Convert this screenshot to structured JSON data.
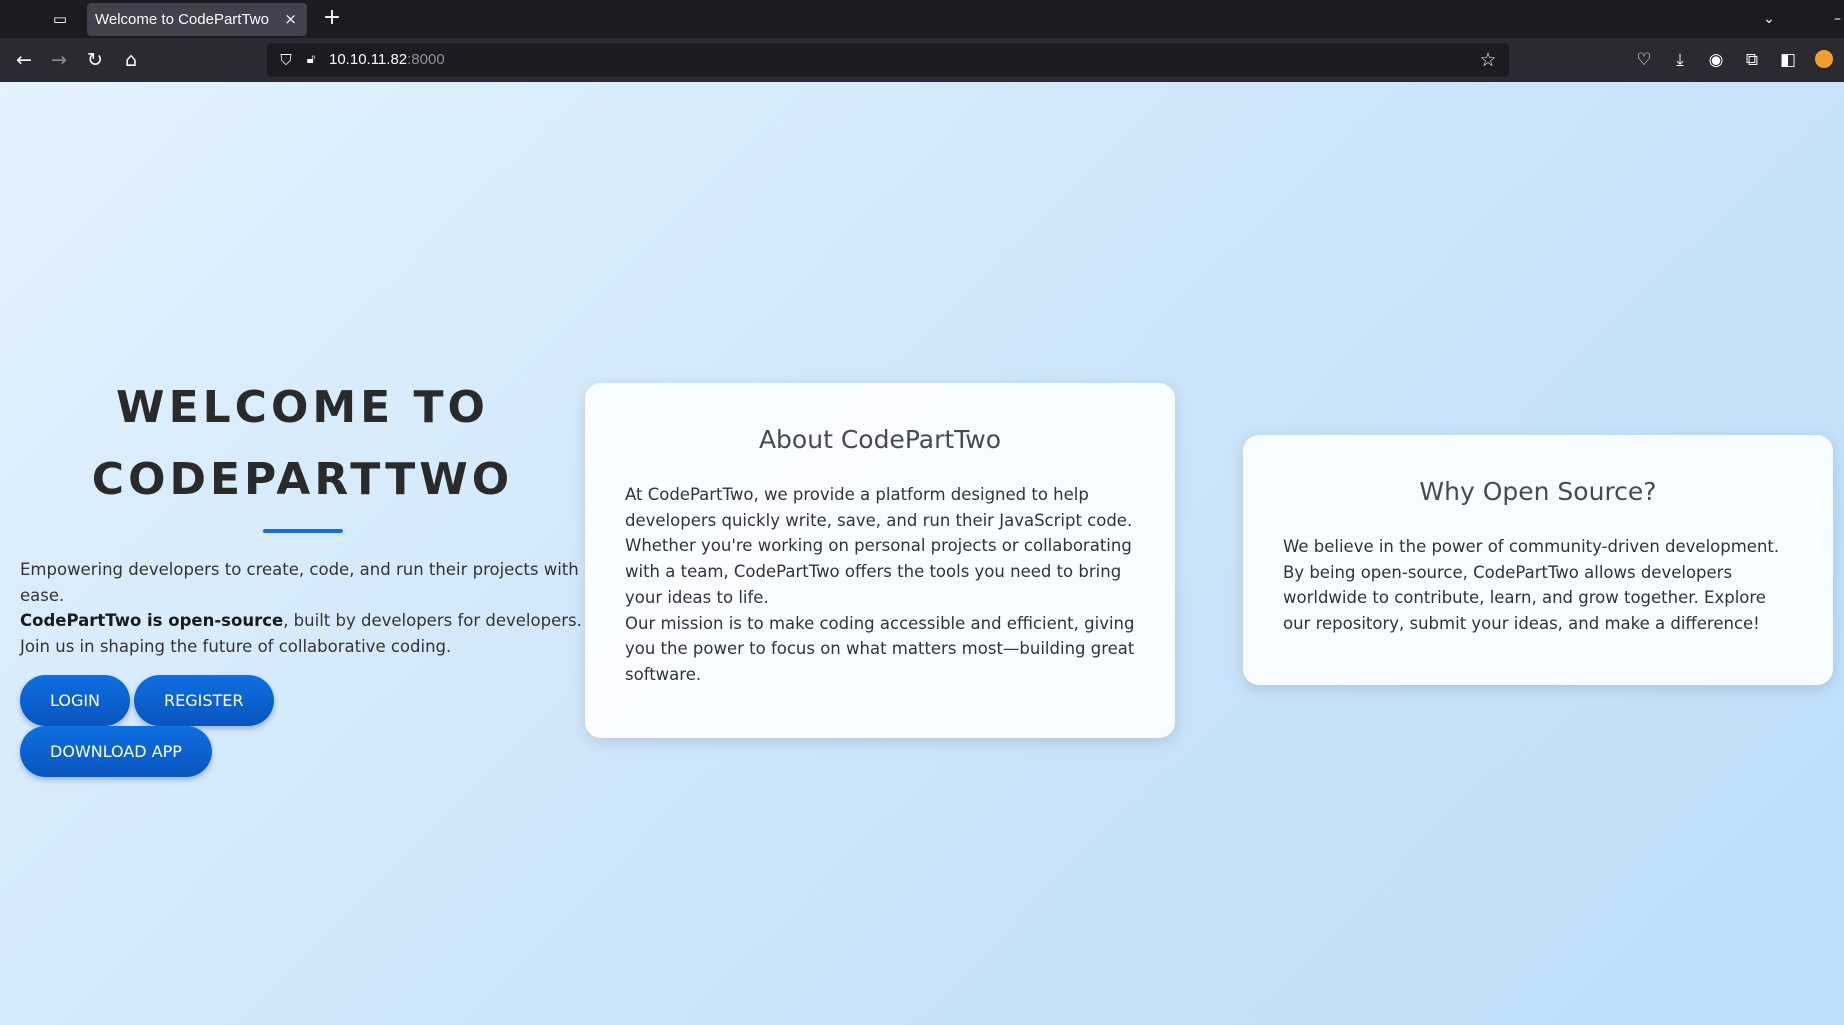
{
  "browser": {
    "tab_title": "Welcome to CodePartTwo",
    "tab_close": "×",
    "new_tab": "+",
    "url_host": "10.10.11.82",
    "url_port": ":8000"
  },
  "hero": {
    "title_line1": "WELCOME TO",
    "title_line2": "CODEPARTTWO",
    "intro": "Empowering developers to create, code, and run their projects with ease.",
    "open_source_bold": "CodePartTwo is open-source",
    "open_source_rest": ", built by developers for developers. Join us in shaping the future of collaborative coding.",
    "buttons": {
      "login": "LOGIN",
      "register": "REGISTER",
      "download": "DOWNLOAD APP"
    }
  },
  "about": {
    "title": "About CodePartTwo",
    "paragraph1": "At CodePartTwo, we provide a platform designed to help developers quickly write, save, and run their JavaScript code. Whether you're working on personal projects or collaborating with a team, CodePartTwo offers the tools you need to bring your ideas to life.",
    "paragraph2": "Our mission is to make coding accessible and efficient, giving you the power to focus on what matters most—building great software."
  },
  "why": {
    "title": "Why Open Source?",
    "paragraph": "We believe in the power of community-driven development. By being open-source, CodePartTwo allows developers worldwide to contribute, learn, and grow together. Explore our repository, submit your ideas, and make a difference!"
  },
  "colors": {
    "button": "#0d6fe0",
    "underline": "#1a6fd6",
    "background_start": "#e3f2fd",
    "background_end": "#bbdefb"
  }
}
